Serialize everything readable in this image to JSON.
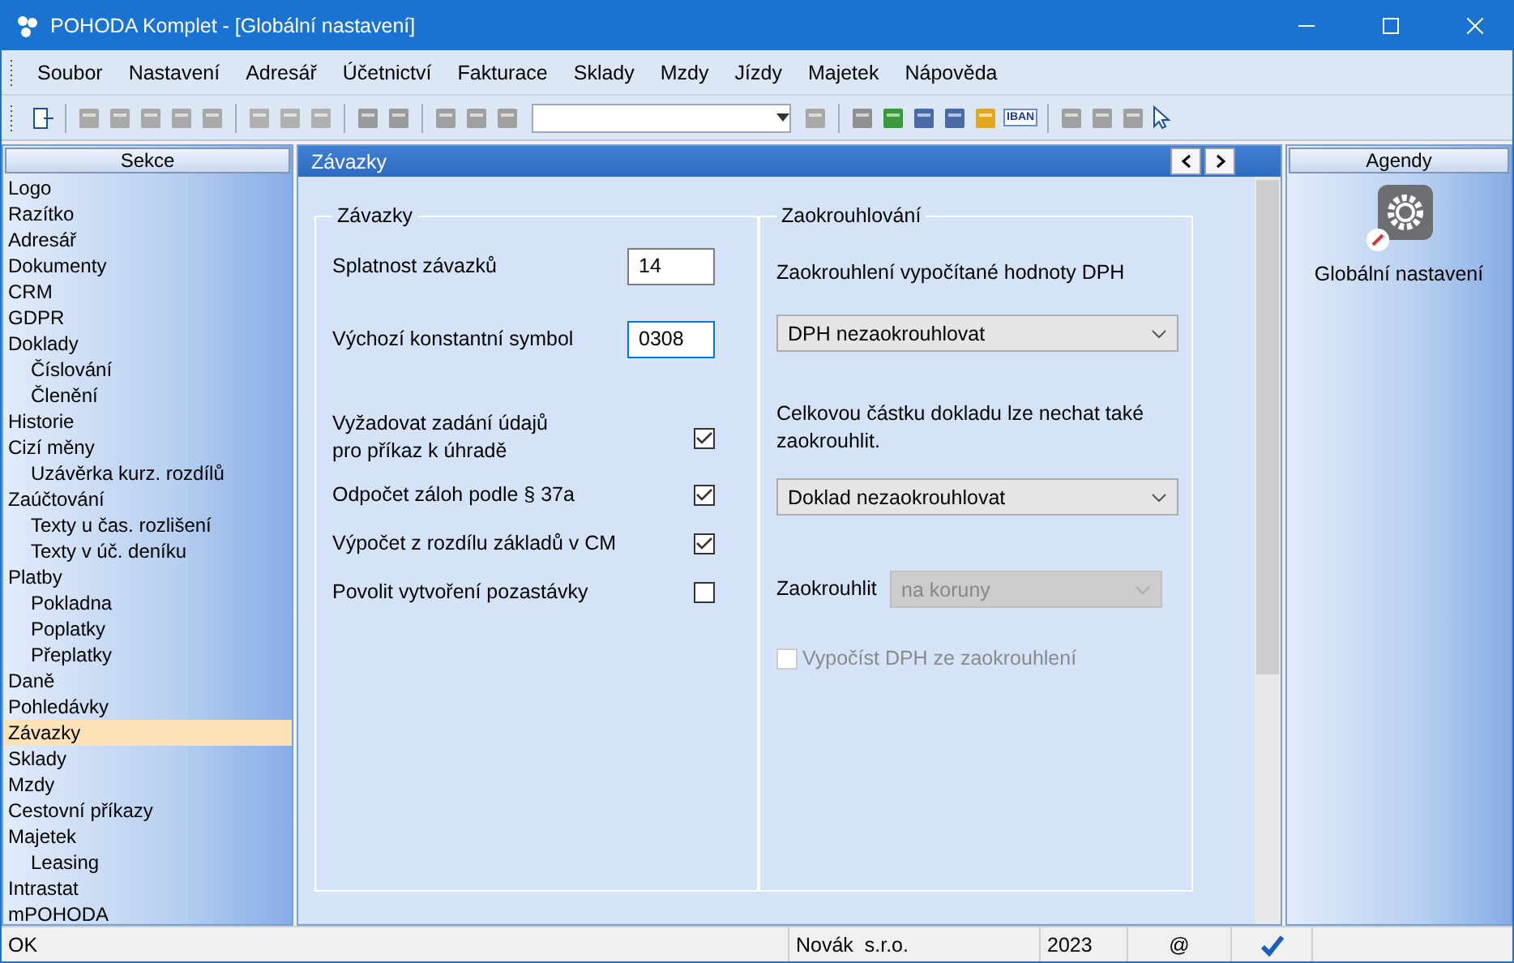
{
  "window": {
    "title": "POHODA Komplet - [Globální nastavení]"
  },
  "menu": [
    {
      "label": "Soubor"
    },
    {
      "label": "Nastavení"
    },
    {
      "label": "Adresář"
    },
    {
      "label": "Účetnictví"
    },
    {
      "label": "Fakturace"
    },
    {
      "label": "Sklady"
    },
    {
      "label": "Mzdy"
    },
    {
      "label": "Jízdy"
    },
    {
      "label": "Majetek"
    },
    {
      "label": "Nápověda"
    }
  ],
  "toolbar": {
    "iban": "IBAN"
  },
  "sidebar": {
    "title": "Sekce",
    "items": [
      {
        "label": "Logo",
        "selected": false
      },
      {
        "label": "Razítko",
        "selected": false
      },
      {
        "label": "Adresář",
        "selected": false
      },
      {
        "label": "Dokumenty",
        "selected": false
      },
      {
        "label": "CRM",
        "selected": false
      },
      {
        "label": "GDPR",
        "selected": false
      },
      {
        "label": "Doklady",
        "selected": false,
        "children": [
          {
            "label": "Číslování",
            "selected": false
          },
          {
            "label": "Členění",
            "selected": false
          }
        ]
      },
      {
        "label": "Historie",
        "selected": false
      },
      {
        "label": "Cizí měny",
        "selected": false,
        "children": [
          {
            "label": "Uzávěrka kurz. rozdílů",
            "selected": false
          }
        ]
      },
      {
        "label": "Zaúčtování",
        "selected": false,
        "children": [
          {
            "label": "Texty u čas. rozlišení",
            "selected": false
          },
          {
            "label": "Texty v úč. deníku",
            "selected": false
          }
        ]
      },
      {
        "label": "Platby",
        "selected": false,
        "children": [
          {
            "label": "Pokladna",
            "selected": false
          },
          {
            "label": "Poplatky",
            "selected": false
          },
          {
            "label": "Přeplatky",
            "selected": false
          }
        ]
      },
      {
        "label": "Daně",
        "selected": false
      },
      {
        "label": "Pohledávky",
        "selected": false
      },
      {
        "label": "Závazky",
        "selected": true
      },
      {
        "label": "Sklady",
        "selected": false
      },
      {
        "label": "Mzdy",
        "selected": false
      },
      {
        "label": "Cestovní příkazy",
        "selected": false
      },
      {
        "label": "Majetek",
        "selected": false,
        "children": [
          {
            "label": "Leasing",
            "selected": false
          }
        ]
      },
      {
        "label": "Intrastat",
        "selected": false
      },
      {
        "label": "mPOHODA",
        "selected": false
      }
    ]
  },
  "panel": {
    "title": "Závazky",
    "left_group": {
      "title": "Závazky",
      "fields": [
        {
          "label": "Splatnost závazků",
          "value": "14",
          "focused": false
        },
        {
          "label": "Výchozí konstantní symbol",
          "value": "0308",
          "focused": true
        }
      ],
      "checks": [
        {
          "label": "Vyžadovat zadání údajů\npro příkaz k úhradě",
          "checked": true
        },
        {
          "label": "Odpočet záloh podle § 37a",
          "checked": true
        },
        {
          "label": "Výpočet z rozdílu základů v CM",
          "checked": true
        },
        {
          "label": "Povolit vytvoření pozastávky",
          "checked": false
        }
      ]
    },
    "right_group": {
      "title": "Zaokrouhlování",
      "vat_label": "Zaokrouhlení vypočítané hodnoty DPH",
      "vat_select": {
        "value": "DPH nezaokrouhlovat",
        "disabled": false
      },
      "total_label": "Celkovou částku dokladu lze nechat také\nzaokrouhlit.",
      "total_select": {
        "value": "Doklad nezaokrouhlovat",
        "disabled": false
      },
      "round_label": "Zaokrouhlit",
      "round_select": {
        "value": "na koruny",
        "disabled": true
      },
      "vat_check": {
        "label": "Vypočíst DPH ze zaokrouhlení",
        "checked": false,
        "disabled": true
      }
    }
  },
  "agendy": {
    "title": "Agendy",
    "items": [
      {
        "label": "Globální nastavení"
      }
    ]
  },
  "status_bar": {
    "message": "OK",
    "company": "Novák  s.r.o.",
    "year": "2023",
    "mail": "@"
  }
}
